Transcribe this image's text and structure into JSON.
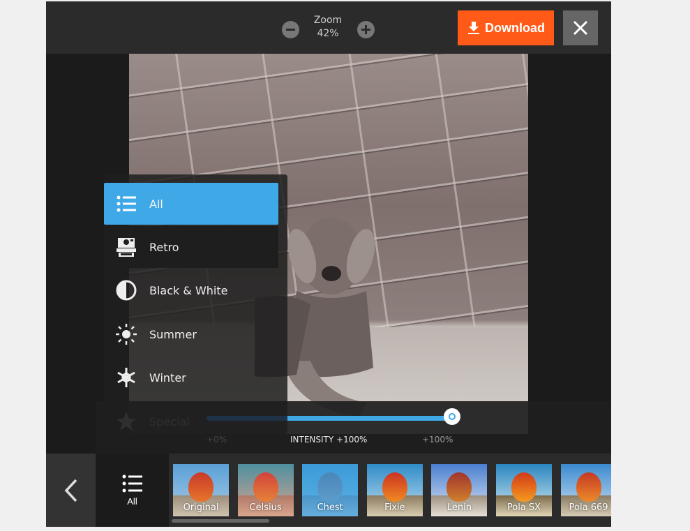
{
  "topbar": {
    "zoom_label": "Zoom",
    "zoom_value": "42%",
    "zoom_out_icon": "minus-circle-icon",
    "zoom_in_icon": "plus-circle-icon",
    "download_label": "Download",
    "download_icon": "download-icon",
    "close_icon": "close-icon"
  },
  "colors": {
    "accent": "#3fa8e7",
    "download": "#ff5a17",
    "topbar_bg": "#2b2b2b",
    "canvas_bg": "#1b1b1b"
  },
  "filter_categories": [
    {
      "label": "All",
      "icon": "list-icon",
      "active": true
    },
    {
      "label": "Retro",
      "icon": "camera-icon",
      "active": false
    },
    {
      "label": "Black & White",
      "icon": "contrast-icon",
      "active": false
    },
    {
      "label": "Summer",
      "icon": "sun-icon",
      "active": false
    },
    {
      "label": "Winter",
      "icon": "snowflake-icon",
      "active": false
    },
    {
      "label": "Special",
      "icon": "star-icon",
      "active": false
    }
  ],
  "intensity": {
    "min_label": "+0%",
    "value_label": "INTENSITY +100%",
    "max_label": "+100%",
    "value_percent": 100
  },
  "bottom": {
    "back_icon": "chevron-left-icon",
    "category_label": "All",
    "category_icon": "list-icon",
    "filters": [
      {
        "label": "Original"
      },
      {
        "label": "Celsius"
      },
      {
        "label": "Chest"
      },
      {
        "label": "Fixie"
      },
      {
        "label": "Lenin"
      },
      {
        "label": "Pola SX"
      },
      {
        "label": "Pola 669"
      }
    ]
  }
}
